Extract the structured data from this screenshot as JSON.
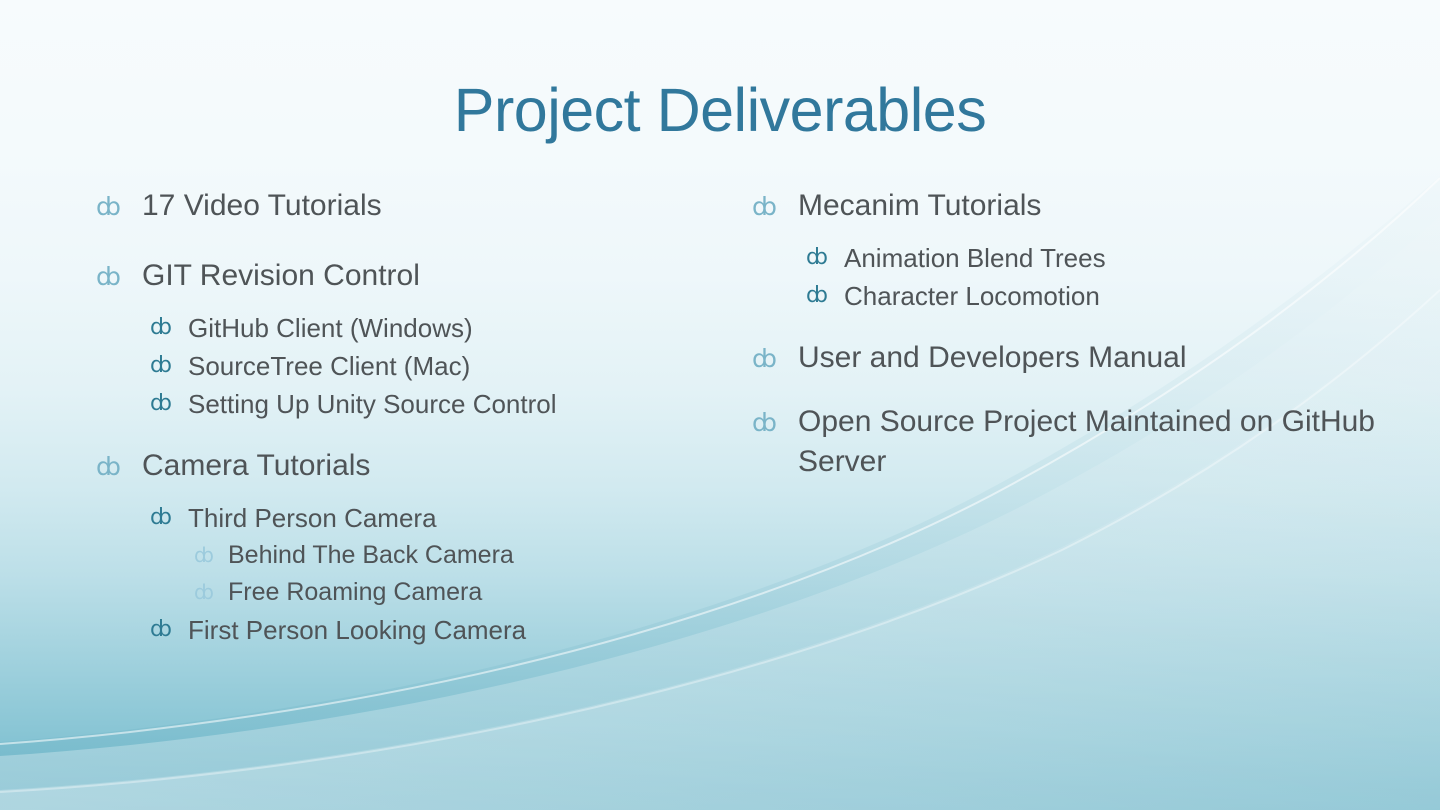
{
  "slide": {
    "title": "Project Deliverables",
    "bullet_glyph": "ȸ",
    "colors": {
      "title": "#31789C",
      "body_text": "#4F5457",
      "bullet_level1": "#7AB4C8",
      "bullet_level2": "#2E7B93",
      "bullet_level3": "#9CCBDD",
      "background_top": "#F7FBFD",
      "background_bottom": "#6FB7CA"
    }
  },
  "left_column": {
    "items": [
      {
        "level": 1,
        "text": "17 Video Tutorials"
      },
      {
        "level": 1,
        "text": "GIT Revision Control"
      },
      {
        "level": 2,
        "text": "GitHub Client (Windows)"
      },
      {
        "level": 2,
        "text": "SourceTree Client (Mac)"
      },
      {
        "level": 2,
        "text": "Setting Up Unity Source Control"
      },
      {
        "level": 1,
        "text": "Camera Tutorials"
      },
      {
        "level": 2,
        "text": "Third Person Camera"
      },
      {
        "level": 3,
        "text": "Behind The Back Camera"
      },
      {
        "level": 3,
        "text": "Free Roaming Camera"
      },
      {
        "level": 2,
        "text": "First Person Looking Camera"
      }
    ]
  },
  "right_column": {
    "items": [
      {
        "level": 1,
        "text": "Mecanim Tutorials"
      },
      {
        "level": 2,
        "text": "Animation Blend Trees"
      },
      {
        "level": 2,
        "text": "Character Locomotion"
      },
      {
        "level": 1,
        "text": "User and Developers Manual"
      },
      {
        "level": 1,
        "text": "Open Source Project Maintained on GitHub Server"
      }
    ]
  }
}
